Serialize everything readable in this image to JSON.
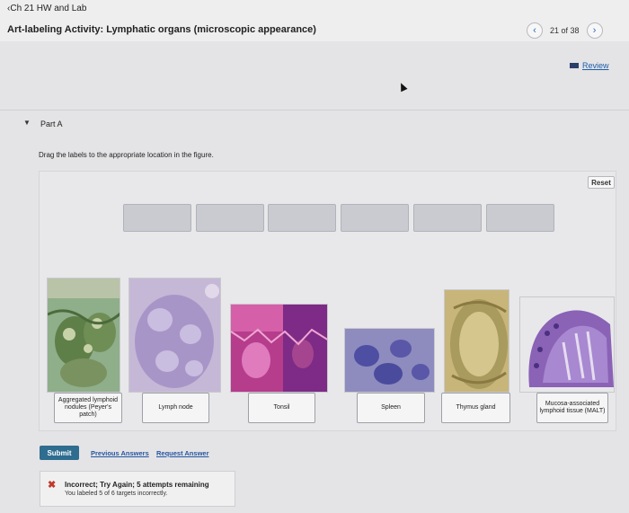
{
  "header": {
    "back_label": "Ch 21 HW and Lab",
    "title": "Art-labeling Activity: Lymphatic organs (microscopic appearance)",
    "pager": "21 of 38",
    "prev_icon": "chevron-left-icon",
    "next_icon": "chevron-right-icon"
  },
  "review": {
    "label": "Review"
  },
  "part": {
    "label": "Part A"
  },
  "instructions": "Drag the labels to the appropriate location in the figure.",
  "reset_label": "Reset",
  "labels": [
    {
      "text": "Aggregated lymphoid nodules (Peyer's patch)"
    },
    {
      "text": "Lymph node"
    },
    {
      "text": "Tonsil"
    },
    {
      "text": "Spleen"
    },
    {
      "text": "Thymus gland"
    },
    {
      "text": "Mucosa-associated lymphoid tissue (MALT)"
    }
  ],
  "actions": {
    "submit": "Submit",
    "previous_answers": "Previous Answers",
    "request_answer": "Request Answer"
  },
  "feedback": {
    "heading": "Incorrect; Try Again; 5 attempts remaining",
    "detail": "You labeled 5 of 6 targets incorrectly."
  },
  "colors": {
    "accent": "#2e6d8f",
    "link": "#2455a0",
    "error": "#c0392b"
  }
}
